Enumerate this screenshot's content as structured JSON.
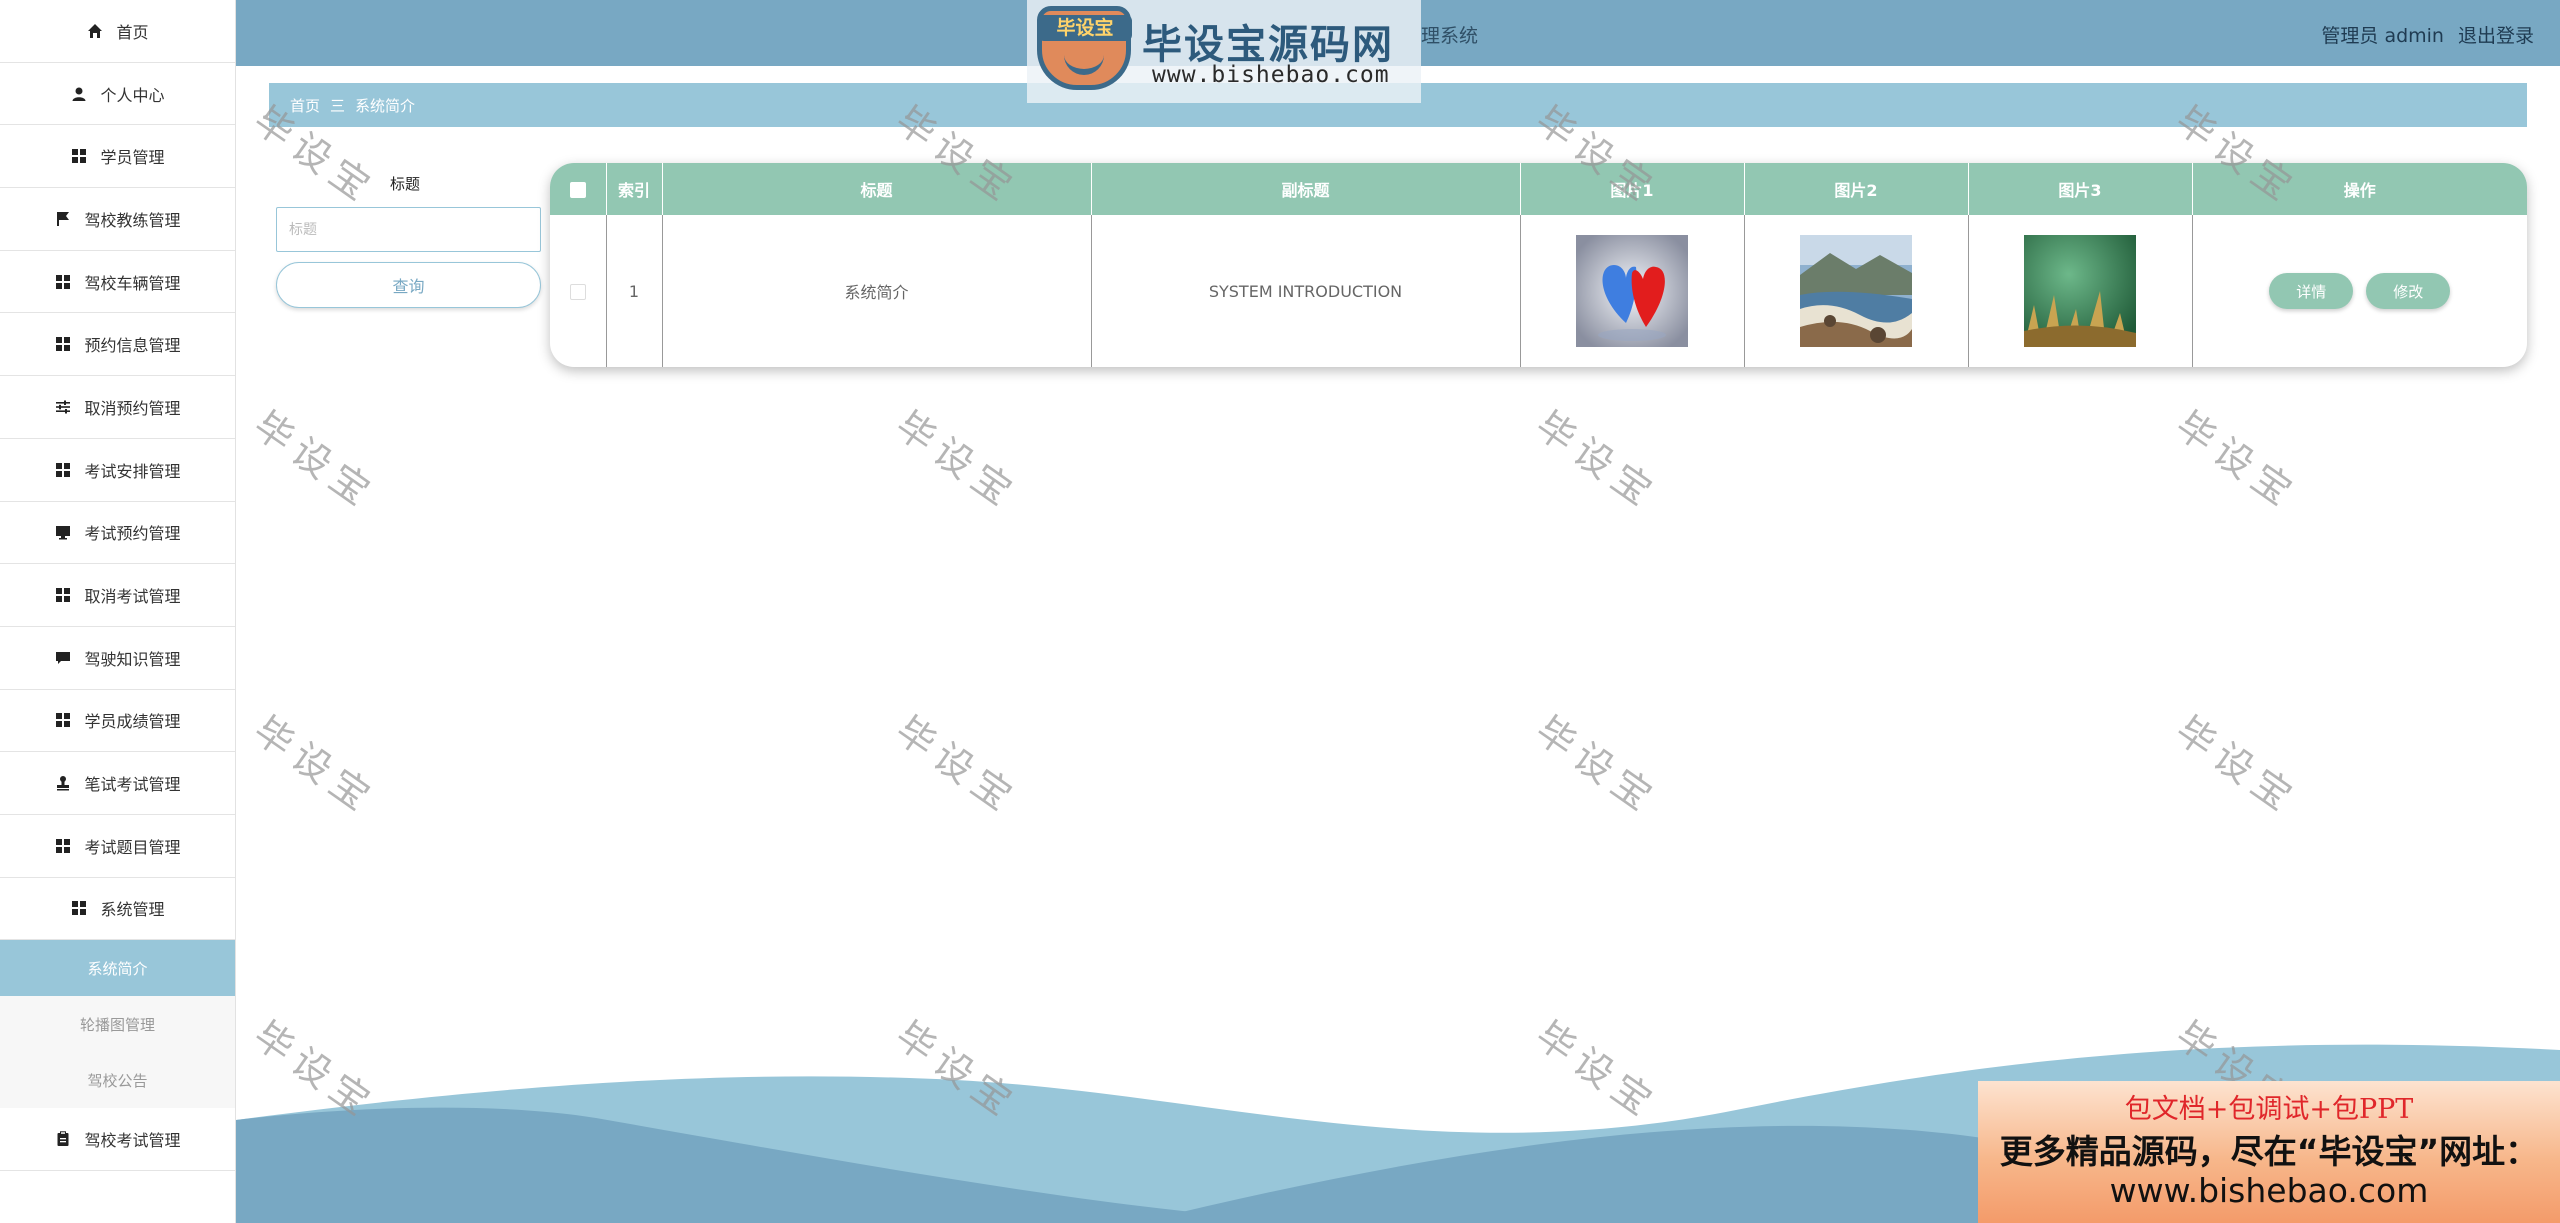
{
  "sidebar": {
    "items": [
      {
        "label": "首页",
        "icon": "home-icon"
      },
      {
        "label": "个人中心",
        "icon": "user-icon"
      },
      {
        "label": "学员管理",
        "icon": "grid-icon"
      },
      {
        "label": "驾校教练管理",
        "icon": "flag-icon"
      },
      {
        "label": "驾校车辆管理",
        "icon": "grid-icon"
      },
      {
        "label": "预约信息管理",
        "icon": "grid-icon"
      },
      {
        "label": "取消预约管理",
        "icon": "sliders-icon"
      },
      {
        "label": "考试安排管理",
        "icon": "grid-icon"
      },
      {
        "label": "考试预约管理",
        "icon": "monitor-icon"
      },
      {
        "label": "取消考试管理",
        "icon": "grid-icon"
      },
      {
        "label": "驾驶知识管理",
        "icon": "chat-icon"
      },
      {
        "label": "学员成绩管理",
        "icon": "grid-icon"
      },
      {
        "label": "笔试考试管理",
        "icon": "stamp-icon"
      },
      {
        "label": "考试题目管理",
        "icon": "grid-icon"
      },
      {
        "label": "系统管理",
        "icon": "grid-icon"
      }
    ],
    "sub_items": [
      {
        "label": "系统简介",
        "active": true
      },
      {
        "label": "轮播图管理",
        "active": false
      },
      {
        "label": "驾校公告",
        "active": false
      }
    ],
    "last_item": {
      "label": "驾校考试管理",
      "icon": "clipboard-icon"
    }
  },
  "header": {
    "title_fragment": "理系统",
    "user_label": "管理员 admin",
    "logout_label": "退出登录"
  },
  "logo": {
    "badge_text": "毕设宝",
    "brand": "毕设宝源码网",
    "url": "www.bishebao.com"
  },
  "breadcrumb": {
    "home": "首页",
    "separator": "三",
    "current": "系统简介"
  },
  "search": {
    "label": "标题",
    "placeholder": "标题",
    "button": "查询"
  },
  "table": {
    "headers": [
      "索引",
      "标题",
      "副标题",
      "图片1",
      "图片2",
      "图片3",
      "操作"
    ],
    "rows": [
      {
        "index": "1",
        "title": "系统简介",
        "subtitle": "SYSTEM INTRODUCTION",
        "images": [
          "hearts-image",
          "coast-image",
          "grass-image"
        ],
        "actions": [
          "详情",
          "修改"
        ]
      }
    ]
  },
  "watermark": "毕设宝",
  "ad": {
    "line1": "包文档+包调试+包PPT",
    "line2": "更多精品源码，尽在“毕设宝”网址：",
    "line3": "www.bishebao.com"
  },
  "colors": {
    "header_bg": "#78a8c3",
    "breadcrumb_bg": "#98c6d9",
    "table_header_bg": "#92c7b2",
    "active_sub_bg": "#98c6d9"
  }
}
